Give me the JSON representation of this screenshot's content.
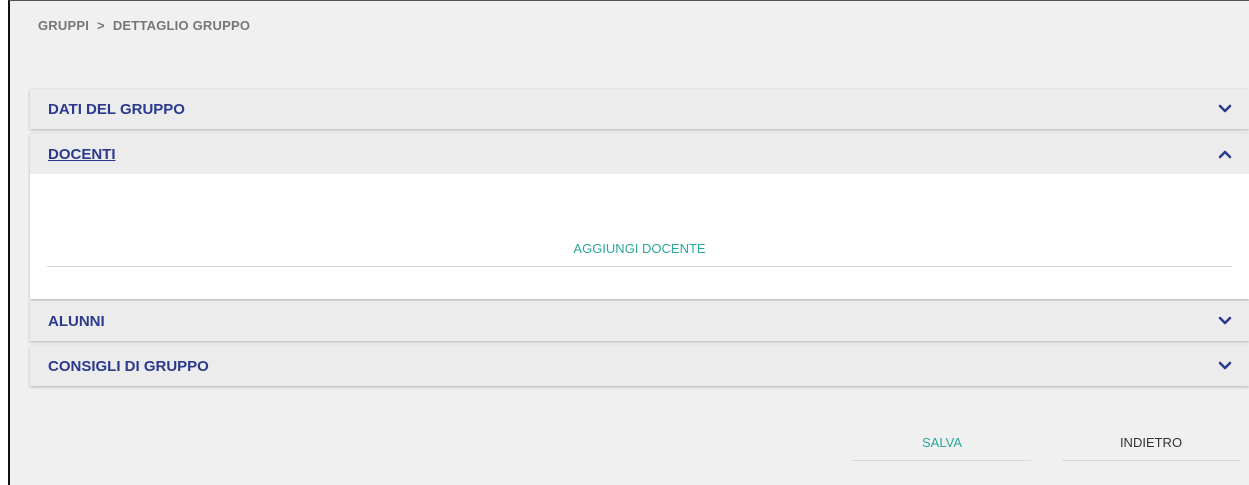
{
  "breadcrumb": {
    "items": [
      "GRUPPI",
      "DETTAGLIO GRUPPO"
    ],
    "separator": ">"
  },
  "panels": [
    {
      "title": "DATI DEL GRUPPO",
      "expanded": false,
      "icon": "chevron-down-icon"
    },
    {
      "title": "DOCENTI",
      "expanded": true,
      "icon": "chevron-up-icon",
      "add_label": "AGGIUNGI DOCENTE"
    },
    {
      "title": "ALUNNI",
      "expanded": false,
      "icon": "chevron-down-icon"
    },
    {
      "title": "CONSIGLI DI GRUPPO",
      "expanded": false,
      "icon": "chevron-down-icon"
    }
  ],
  "actions": {
    "save_label": "SALVA",
    "back_label": "INDIETRO"
  },
  "colors": {
    "title": "#2b3a8c",
    "accent": "#2aa79b",
    "panel_bg": "#ececec",
    "page_bg": "#f0f0f0"
  }
}
